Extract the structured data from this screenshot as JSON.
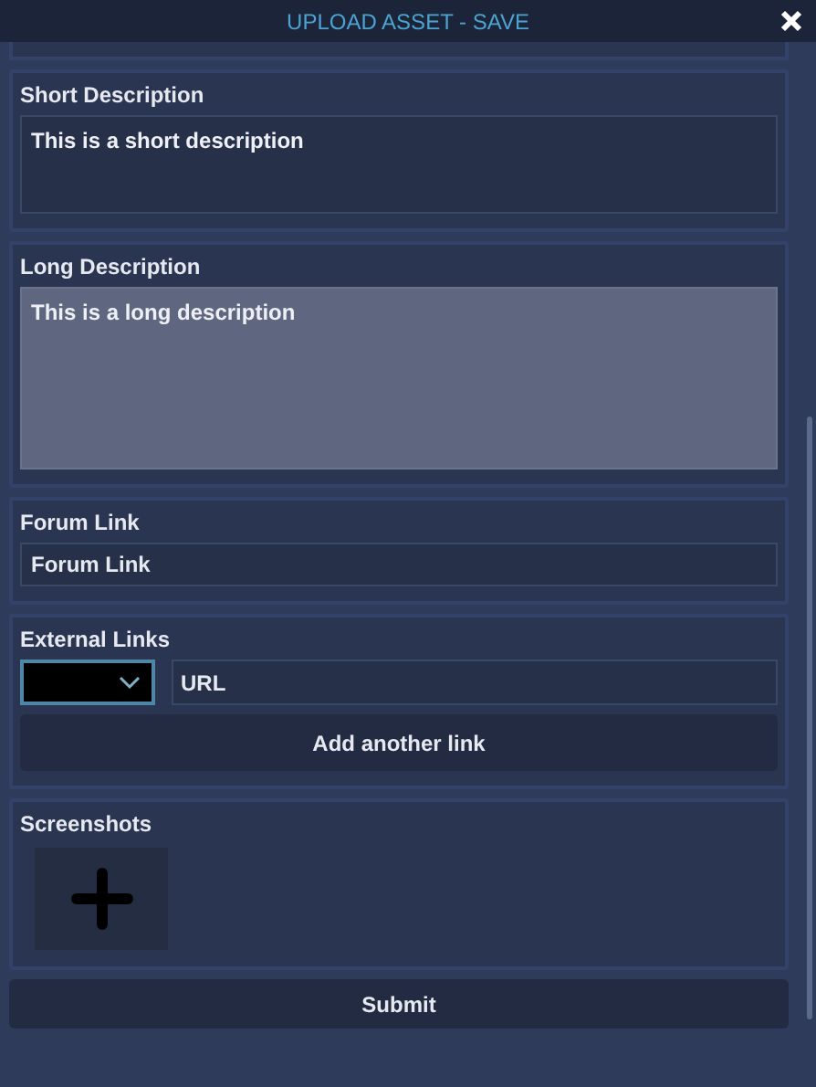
{
  "window": {
    "title": "UPLOAD ASSET - SAVE"
  },
  "sections": [
    {
      "kind": "textarea",
      "label": "Short Description",
      "value": "This is a short description",
      "focused": false
    },
    {
      "kind": "textarea",
      "label": "Long Description",
      "value": "This is a long description",
      "focused": true
    },
    {
      "kind": "input",
      "label": "Forum Link",
      "placeholder": "Forum Link"
    },
    {
      "kind": "links",
      "label": "External Links",
      "select_focused": true,
      "url_placeholder": "URL",
      "add_button": "Add another link"
    },
    {
      "kind": "screenshots",
      "label": "Screenshots"
    }
  ],
  "submit_button": "Submit"
}
